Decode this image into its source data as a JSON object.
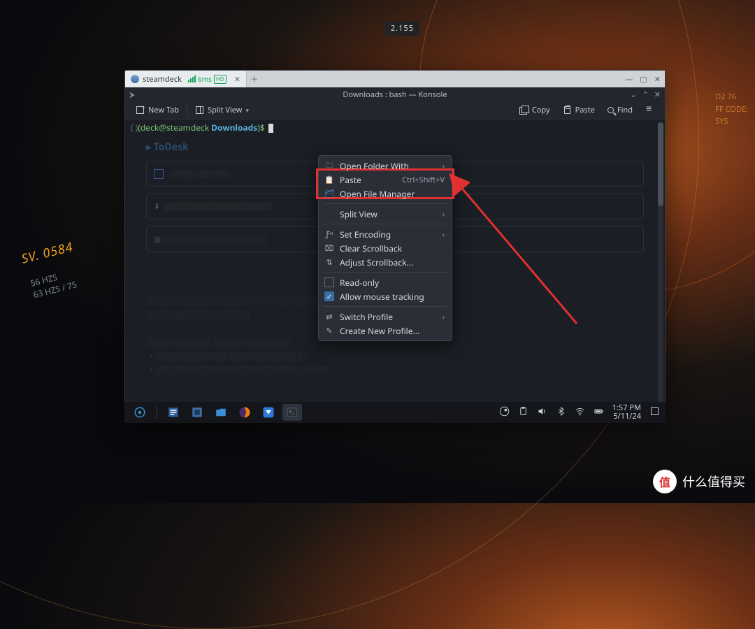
{
  "wallpaper": {
    "badge": "2.155",
    "sv": "SV. 0584",
    "hz1": "56 HZS",
    "hz2": "63 HZS  /  75",
    "right1": "D2   76",
    "right2": "FF CODE:",
    "right3": "SYS"
  },
  "outer_tab": {
    "title": "steamdeck",
    "ping": "6ms",
    "hd": "HD"
  },
  "konsole": {
    "title": "Downloads : bash — Konsole",
    "toolbar": {
      "new_tab": "New Tab",
      "split_view": "Split View",
      "copy": "Copy",
      "paste": "Paste",
      "find": "Find"
    },
    "prompt": {
      "brackets": "( )",
      "userhost": "(deck@steamdeck",
      "cwd": "Downloads",
      "end": ")$"
    }
  },
  "context_menu": {
    "open_folder_with": "Open Folder With",
    "paste": "Paste",
    "paste_accel": "Ctrl+Shift+V",
    "open_file_manager": "Open File Manager",
    "split_view": "Split View",
    "set_encoding": "Set Encoding",
    "clear_scrollback": "Clear Scrollback",
    "adjust_scrollback": "Adjust Scrollback...",
    "read_only": "Read-only",
    "allow_mouse": "Allow mouse tracking",
    "switch_profile": "Switch Profile",
    "create_profile": "Create New Profile..."
  },
  "taskbar": {
    "time": "1:57 PM",
    "date": "5/11/24"
  },
  "watermark": {
    "badge": "值",
    "text": "什么值得买"
  }
}
